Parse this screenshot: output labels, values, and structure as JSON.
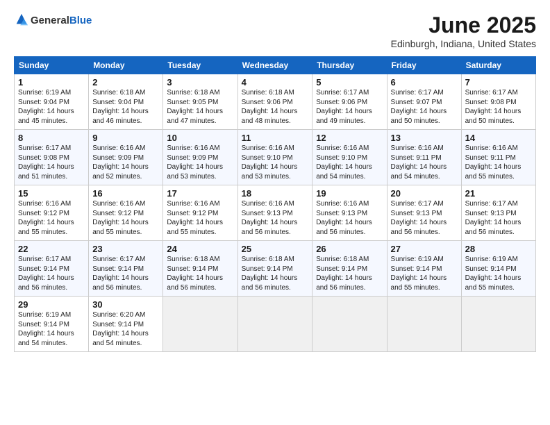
{
  "header": {
    "logo_general": "General",
    "logo_blue": "Blue",
    "month": "June 2025",
    "location": "Edinburgh, Indiana, United States"
  },
  "days_of_week": [
    "Sunday",
    "Monday",
    "Tuesday",
    "Wednesday",
    "Thursday",
    "Friday",
    "Saturday"
  ],
  "weeks": [
    [
      {
        "day": "1",
        "sunrise": "Sunrise: 6:19 AM",
        "sunset": "Sunset: 9:04 PM",
        "daylight": "Daylight: 14 hours and 45 minutes."
      },
      {
        "day": "2",
        "sunrise": "Sunrise: 6:18 AM",
        "sunset": "Sunset: 9:04 PM",
        "daylight": "Daylight: 14 hours and 46 minutes."
      },
      {
        "day": "3",
        "sunrise": "Sunrise: 6:18 AM",
        "sunset": "Sunset: 9:05 PM",
        "daylight": "Daylight: 14 hours and 47 minutes."
      },
      {
        "day": "4",
        "sunrise": "Sunrise: 6:18 AM",
        "sunset": "Sunset: 9:06 PM",
        "daylight": "Daylight: 14 hours and 48 minutes."
      },
      {
        "day": "5",
        "sunrise": "Sunrise: 6:17 AM",
        "sunset": "Sunset: 9:06 PM",
        "daylight": "Daylight: 14 hours and 49 minutes."
      },
      {
        "day": "6",
        "sunrise": "Sunrise: 6:17 AM",
        "sunset": "Sunset: 9:07 PM",
        "daylight": "Daylight: 14 hours and 50 minutes."
      },
      {
        "day": "7",
        "sunrise": "Sunrise: 6:17 AM",
        "sunset": "Sunset: 9:08 PM",
        "daylight": "Daylight: 14 hours and 50 minutes."
      }
    ],
    [
      {
        "day": "8",
        "sunrise": "Sunrise: 6:17 AM",
        "sunset": "Sunset: 9:08 PM",
        "daylight": "Daylight: 14 hours and 51 minutes."
      },
      {
        "day": "9",
        "sunrise": "Sunrise: 6:16 AM",
        "sunset": "Sunset: 9:09 PM",
        "daylight": "Daylight: 14 hours and 52 minutes."
      },
      {
        "day": "10",
        "sunrise": "Sunrise: 6:16 AM",
        "sunset": "Sunset: 9:09 PM",
        "daylight": "Daylight: 14 hours and 53 minutes."
      },
      {
        "day": "11",
        "sunrise": "Sunrise: 6:16 AM",
        "sunset": "Sunset: 9:10 PM",
        "daylight": "Daylight: 14 hours and 53 minutes."
      },
      {
        "day": "12",
        "sunrise": "Sunrise: 6:16 AM",
        "sunset": "Sunset: 9:10 PM",
        "daylight": "Daylight: 14 hours and 54 minutes."
      },
      {
        "day": "13",
        "sunrise": "Sunrise: 6:16 AM",
        "sunset": "Sunset: 9:11 PM",
        "daylight": "Daylight: 14 hours and 54 minutes."
      },
      {
        "day": "14",
        "sunrise": "Sunrise: 6:16 AM",
        "sunset": "Sunset: 9:11 PM",
        "daylight": "Daylight: 14 hours and 55 minutes."
      }
    ],
    [
      {
        "day": "15",
        "sunrise": "Sunrise: 6:16 AM",
        "sunset": "Sunset: 9:12 PM",
        "daylight": "Daylight: 14 hours and 55 minutes."
      },
      {
        "day": "16",
        "sunrise": "Sunrise: 6:16 AM",
        "sunset": "Sunset: 9:12 PM",
        "daylight": "Daylight: 14 hours and 55 minutes."
      },
      {
        "day": "17",
        "sunrise": "Sunrise: 6:16 AM",
        "sunset": "Sunset: 9:12 PM",
        "daylight": "Daylight: 14 hours and 55 minutes."
      },
      {
        "day": "18",
        "sunrise": "Sunrise: 6:16 AM",
        "sunset": "Sunset: 9:13 PM",
        "daylight": "Daylight: 14 hours and 56 minutes."
      },
      {
        "day": "19",
        "sunrise": "Sunrise: 6:16 AM",
        "sunset": "Sunset: 9:13 PM",
        "daylight": "Daylight: 14 hours and 56 minutes."
      },
      {
        "day": "20",
        "sunrise": "Sunrise: 6:17 AM",
        "sunset": "Sunset: 9:13 PM",
        "daylight": "Daylight: 14 hours and 56 minutes."
      },
      {
        "day": "21",
        "sunrise": "Sunrise: 6:17 AM",
        "sunset": "Sunset: 9:13 PM",
        "daylight": "Daylight: 14 hours and 56 minutes."
      }
    ],
    [
      {
        "day": "22",
        "sunrise": "Sunrise: 6:17 AM",
        "sunset": "Sunset: 9:14 PM",
        "daylight": "Daylight: 14 hours and 56 minutes."
      },
      {
        "day": "23",
        "sunrise": "Sunrise: 6:17 AM",
        "sunset": "Sunset: 9:14 PM",
        "daylight": "Daylight: 14 hours and 56 minutes."
      },
      {
        "day": "24",
        "sunrise": "Sunrise: 6:18 AM",
        "sunset": "Sunset: 9:14 PM",
        "daylight": "Daylight: 14 hours and 56 minutes."
      },
      {
        "day": "25",
        "sunrise": "Sunrise: 6:18 AM",
        "sunset": "Sunset: 9:14 PM",
        "daylight": "Daylight: 14 hours and 56 minutes."
      },
      {
        "day": "26",
        "sunrise": "Sunrise: 6:18 AM",
        "sunset": "Sunset: 9:14 PM",
        "daylight": "Daylight: 14 hours and 56 minutes."
      },
      {
        "day": "27",
        "sunrise": "Sunrise: 6:19 AM",
        "sunset": "Sunset: 9:14 PM",
        "daylight": "Daylight: 14 hours and 55 minutes."
      },
      {
        "day": "28",
        "sunrise": "Sunrise: 6:19 AM",
        "sunset": "Sunset: 9:14 PM",
        "daylight": "Daylight: 14 hours and 55 minutes."
      }
    ],
    [
      {
        "day": "29",
        "sunrise": "Sunrise: 6:19 AM",
        "sunset": "Sunset: 9:14 PM",
        "daylight": "Daylight: 14 hours and 54 minutes."
      },
      {
        "day": "30",
        "sunrise": "Sunrise: 6:20 AM",
        "sunset": "Sunset: 9:14 PM",
        "daylight": "Daylight: 14 hours and 54 minutes."
      },
      null,
      null,
      null,
      null,
      null
    ]
  ]
}
